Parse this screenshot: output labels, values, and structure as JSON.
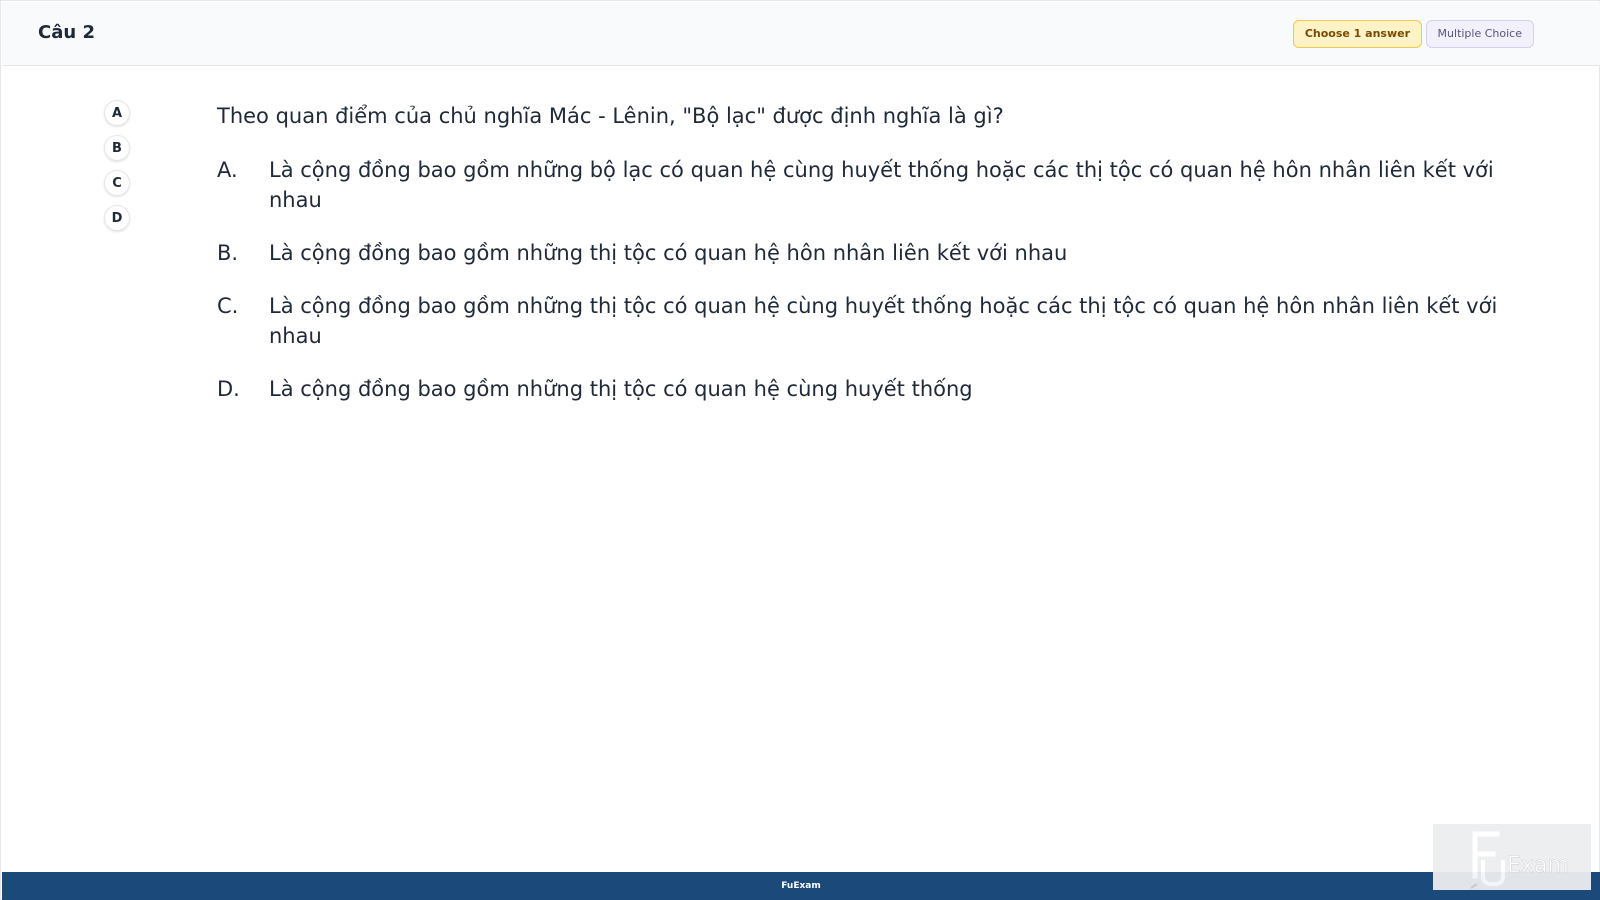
{
  "header": {
    "question_label": "Câu 2",
    "choose_badge": "Choose 1 answer",
    "type_badge": "Multiple Choice"
  },
  "answer_bubbles": [
    "A",
    "B",
    "C",
    "D"
  ],
  "question": {
    "text": "Theo quan điểm của chủ nghĩa Mác - Lênin, \"Bộ lạc\" được định nghĩa là gì?",
    "options": [
      {
        "letter": "A.",
        "text": "Là cộng đồng bao gồm những bộ lạc có quan hệ cùng huyết thống hoặc các thị tộc có quan hệ hôn nhân liên kết với nhau"
      },
      {
        "letter": "B.",
        "text": "Là cộng đồng bao gồm những thị tộc có quan hệ hôn nhân liên kết với nhau"
      },
      {
        "letter": "C.",
        "text": "Là cộng đồng bao gồm những thị tộc có quan hệ cùng huyết thống hoặc các thị tộc có quan hệ hôn nhân liên kết với nhau"
      },
      {
        "letter": "D.",
        "text": "Là cộng đồng bao gồm những thị tộc có quan hệ cùng huyết thống"
      }
    ]
  },
  "footer": {
    "brand": "FuExam"
  },
  "logo": {
    "text": "Exam"
  },
  "colors": {
    "footer_bg": "#1b4a7a",
    "badge_yellow": "#fef3c7",
    "badge_purple": "#f1f0fb"
  }
}
